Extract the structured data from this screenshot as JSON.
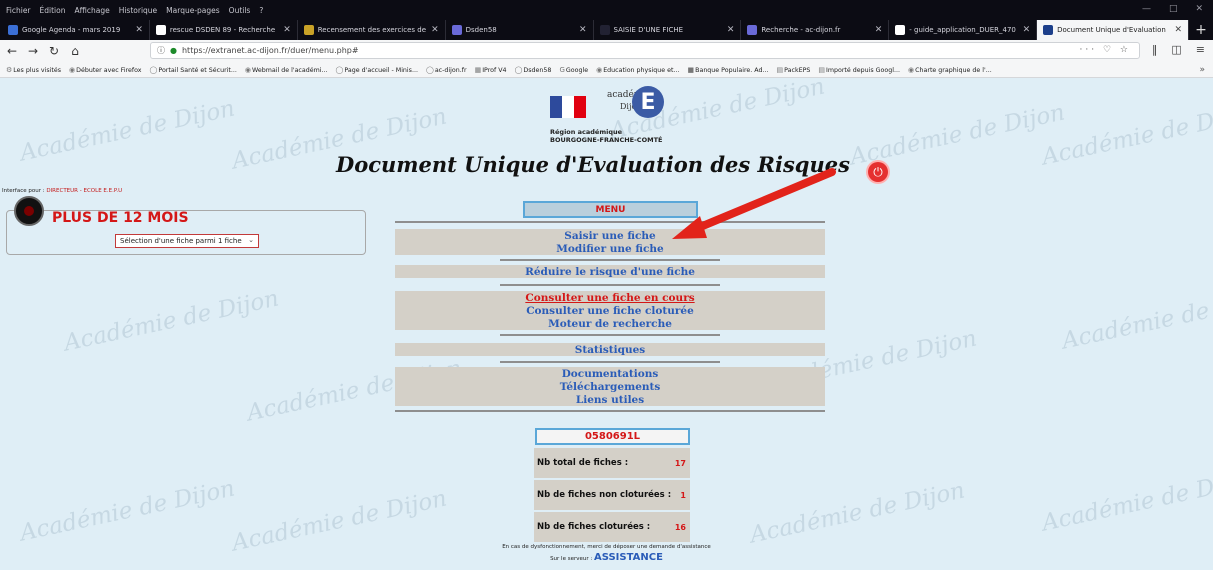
{
  "browser": {
    "menu": [
      "Fichier",
      "Édition",
      "Affichage",
      "Historique",
      "Marque-pages",
      "Outils",
      "?"
    ],
    "tabs": [
      {
        "label": "Google Agenda - mars 2019",
        "color": "#3b6fd6"
      },
      {
        "label": "rescue DSDEN 89 - Recherche",
        "color": "#ffffff"
      },
      {
        "label": "Recensement des exercices de",
        "color": "#c9a227"
      },
      {
        "label": "Dsden58",
        "color": "#6a6ad8"
      },
      {
        "label": "SAISIE D'UNE FICHE",
        "color": "#222233"
      },
      {
        "label": "Recherche - ac-dijon.fr",
        "color": "#6a6ad8"
      },
      {
        "label": "- guide_application_DUER_470",
        "color": "#ffffff"
      },
      {
        "label": "Document Unique d'Evaluation",
        "color": "#1c3f8a"
      }
    ],
    "url": "https://extranet.ac-dijon.fr/duer/menu.php#",
    "bookmarks": [
      "Les plus visités",
      "Débuter avec Firefox",
      "Portail Santé et Sécurit...",
      "Webmail de l'académi...",
      "Page d'accueil - Minis...",
      "ac-dijon.fr",
      "IProf V4",
      "Dsden58",
      "Google",
      "Education physique et...",
      "Banque Populaire. Ad...",
      "PackEPS",
      "Importé depuis Googl...",
      "Charte graphique de l'..."
    ]
  },
  "page": {
    "watermark": "Académie de Dijon",
    "logo": {
      "academie": "académie",
      "dijon": "Dijon",
      "region_line1": "Région académique",
      "region_line2": "BOURGOGNE-FRANCHE-COMTÉ"
    },
    "title": "Document Unique d'Evaluation des Risques",
    "interface_prefix": "Interface pour : ",
    "interface_role": "DIRECTEUR - ECOLE E.E.P.U",
    "alert": "PLUS DE 12 MOIS",
    "fiche_select": "Sélection d'une fiche parmi 1 fiche",
    "menu_header": "MENU",
    "menu_items": {
      "saisir": "Saisir une fiche",
      "modifier": "Modifier une fiche",
      "reduire": "Réduire le risque d'une fiche",
      "consulter_cours": "Consulter une fiche en cours",
      "consulter_cloturee": "Consulter une fiche cloturée",
      "moteur": "Moteur de recherche",
      "statistiques": "Statistiques",
      "documentations": "Documentations",
      "telechargements": "Téléchargements",
      "liens": "Liens utiles"
    },
    "code": "0580691L",
    "stats": [
      {
        "label": "Nb total de fiches :",
        "value": "17"
      },
      {
        "label": "Nb de fiches non cloturées :",
        "value": "1"
      },
      {
        "label": "Nb de fiches cloturées :",
        "value": "16"
      }
    ],
    "footer_line1": "En cas de dysfonctionnement, merci de déposer une demande d'assistance",
    "footer_prefix": "Sur le serveur : ",
    "footer_server": "ASSISTANCE"
  }
}
